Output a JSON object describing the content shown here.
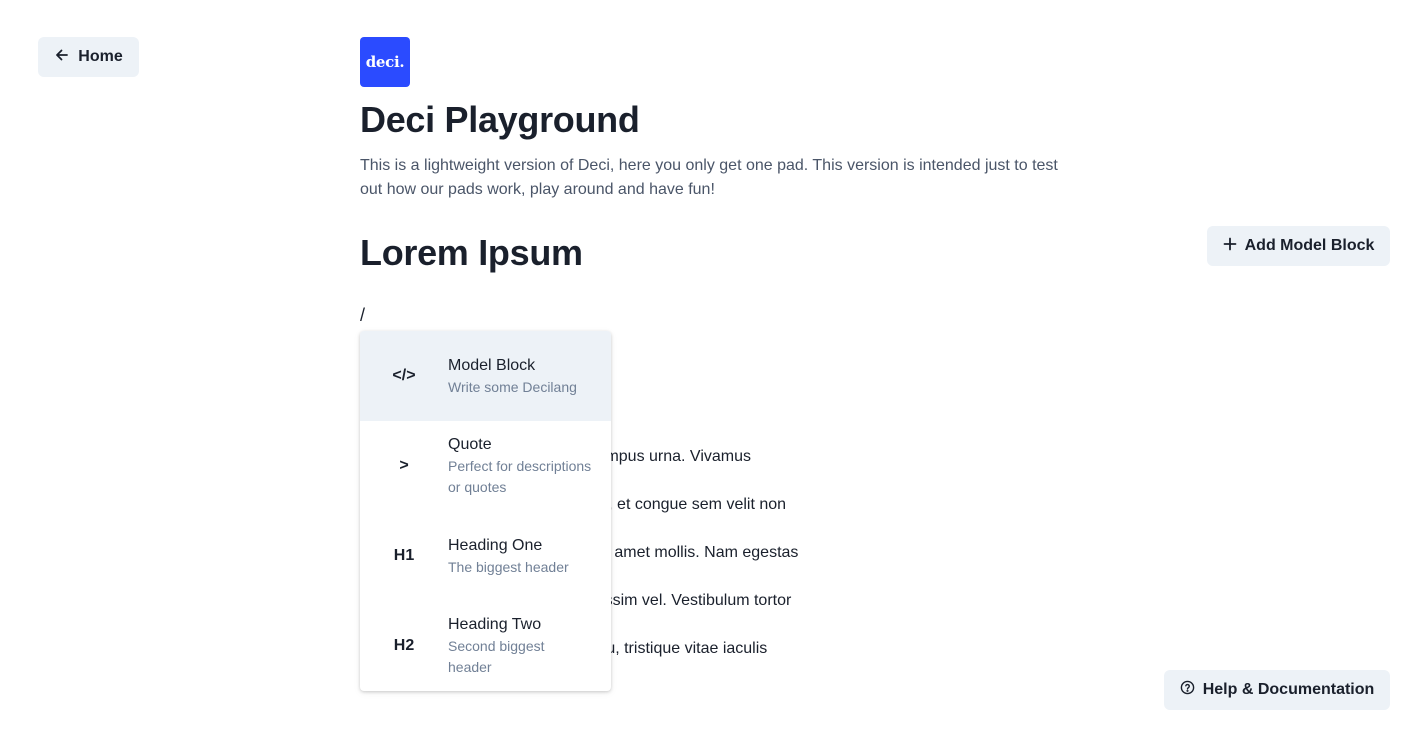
{
  "nav": {
    "home_label": "Home",
    "home_icon": "arrow-left-icon"
  },
  "logo": {
    "text": "deci.",
    "color": "#2b4bff"
  },
  "header": {
    "title": "Deci Playground",
    "description": "This is a lightweight version of Deci, here you only get one pad. This version is intended just to test out how our pads work, play around and have fun!"
  },
  "toolbar": {
    "add_model_block_label": "Add Model Block",
    "add_icon": "plus-icon"
  },
  "pad": {
    "title": "Lorem Ipsum",
    "current_line": "/",
    "body_lines": [
      "ctetur adipiscing elit. Mauris nec tempus urna. Vivamus",
      "m consequat, ligula odio lacinia leo, et congue sem velit non",
      "retium. Aenean aliquam vel urna sit amet mollis. Nam egestas",
      "incidunt nunc, vel gravida dui dignissim vel. Vestibulum tortor",
      "ollis hendrerit est. Nullam dolor arcu, tristique vitae iaculis"
    ]
  },
  "slash_menu": {
    "items": [
      {
        "icon": "</>",
        "label": "Model Block",
        "description": "Write some Decilang",
        "active": true
      },
      {
        "icon": ">",
        "label": "Quote",
        "description": "Perfect for descriptions or quotes",
        "active": false
      },
      {
        "icon": "H1",
        "label": "Heading One",
        "description": "The biggest header",
        "active": false
      },
      {
        "icon": "H2",
        "label": "Heading Two",
        "description": "Second biggest header",
        "active": false
      }
    ]
  },
  "footer": {
    "help_label": "Help & Documentation",
    "help_icon": "question-circle-icon"
  },
  "colors": {
    "button_bg": "#edf2f7",
    "active_item_bg": "#edf2f7",
    "muted_text": "#718096"
  }
}
